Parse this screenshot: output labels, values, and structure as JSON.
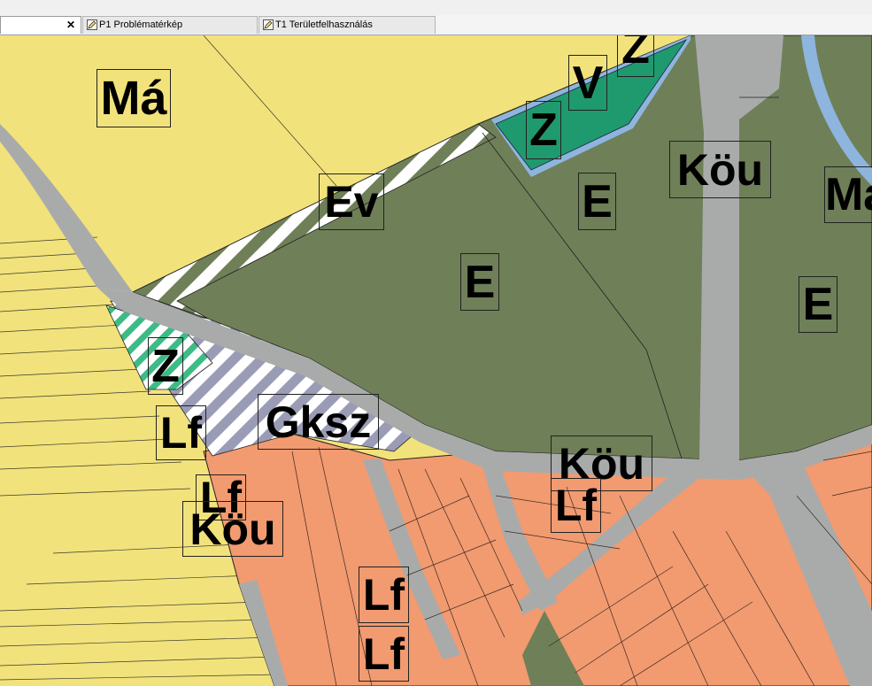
{
  "tabs": [
    {
      "label": "",
      "close_icon": "close-icon",
      "active": true
    },
    {
      "label": "P1 Problématérkép",
      "icon": "pencil-icon",
      "active": false
    },
    {
      "label": "T1 Területfelhasználás",
      "icon": "pencil-icon",
      "active": false
    }
  ],
  "colors": {
    "agricultural_yellow": "#f2e27c",
    "forest_green": "#6f7f58",
    "residential_orange": "#f29a70",
    "road_gray": "#a9abab",
    "park_green": "#1f9a6e",
    "water_blue": "#8eb5de",
    "hatch_gray": "#9a9cb6"
  },
  "zones": [
    {
      "label": "Má"
    },
    {
      "label": "Ev"
    },
    {
      "label": "V"
    },
    {
      "label": "Z"
    },
    {
      "label": "Z"
    },
    {
      "label": "E"
    },
    {
      "label": "E"
    },
    {
      "label": "E"
    },
    {
      "label": "Köu"
    },
    {
      "label": "Má"
    },
    {
      "label": "Z"
    },
    {
      "label": "Lf"
    },
    {
      "label": "Gksz"
    },
    {
      "label": "Lf"
    },
    {
      "label": "Köu"
    },
    {
      "label": "Köu"
    },
    {
      "label": "Lf"
    },
    {
      "label": "Lf"
    },
    {
      "label": "Lf"
    }
  ]
}
